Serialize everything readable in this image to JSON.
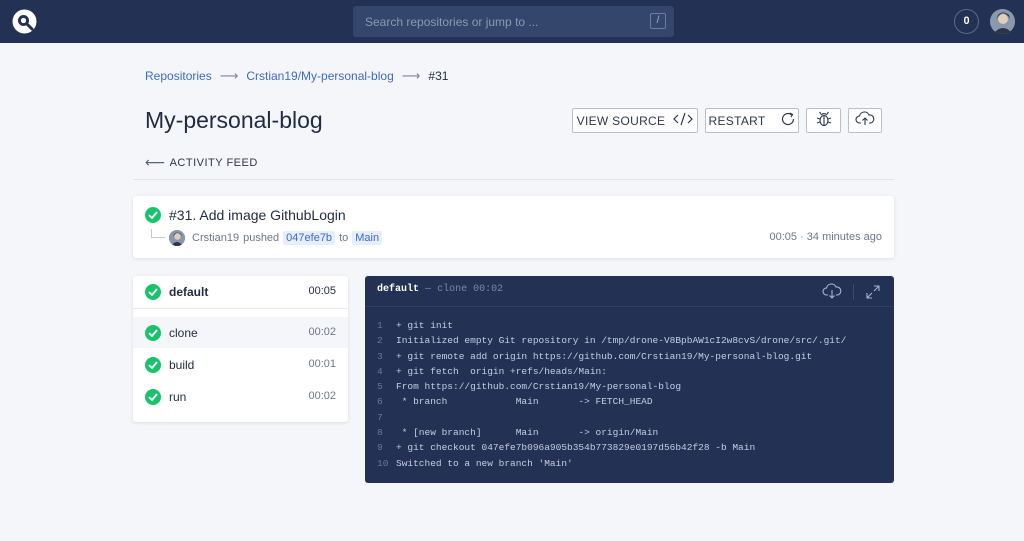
{
  "search": {
    "placeholder": "Search repositories or jump to ...",
    "shortcut": "/"
  },
  "header": {
    "notifications": "0"
  },
  "breadcrumb": {
    "items": [
      "Repositories",
      "Crstian19/My-personal-blog"
    ],
    "current": "#31"
  },
  "repo": {
    "title": "My-personal-blog"
  },
  "actions": {
    "view_source": "VIEW SOURCE",
    "restart": "RESTART"
  },
  "activity_feed": "ACTIVITY FEED",
  "build": {
    "title": "#31. Add image GithubLogin",
    "author": "Crstian19",
    "action": "pushed",
    "commit": "047efe7b",
    "to": "to",
    "branch": "Main",
    "duration": "00:05",
    "time_sep": "·",
    "time_ago": "34 minutes ago"
  },
  "stages": {
    "name": "default",
    "duration": "00:05",
    "steps": [
      {
        "name": "clone",
        "duration": "00:02"
      },
      {
        "name": "build",
        "duration": "00:01"
      },
      {
        "name": "run",
        "duration": "00:02"
      }
    ]
  },
  "log": {
    "stage": "default",
    "dash": "—",
    "step": "clone",
    "duration": "00:02",
    "lines": [
      "+ git init",
      "Initialized empty Git repository in /tmp/drone-V8BpbAW1cI2w8cvS/drone/src/.git/",
      "+ git remote add origin https://github.com/Crstian19/My-personal-blog.git",
      "+ git fetch  origin +refs/heads/Main:",
      "From https://github.com/Crstian19/My-personal-blog",
      " * branch            Main       -> FETCH_HEAD",
      "",
      " * [new branch]      Main       -> origin/Main",
      "+ git checkout 047efe7b096a905b354b773829e0197d56b42f28 -b Main",
      "Switched to a new branch 'Main'"
    ],
    "line_numbers": [
      "1",
      "2",
      "3",
      "4",
      "5",
      "6",
      "7",
      "8",
      "9",
      "10"
    ]
  },
  "colors": {
    "topbar": "#223154",
    "success": "#19c36b",
    "link": "#3a6cc7",
    "log_bg": "#223154"
  }
}
